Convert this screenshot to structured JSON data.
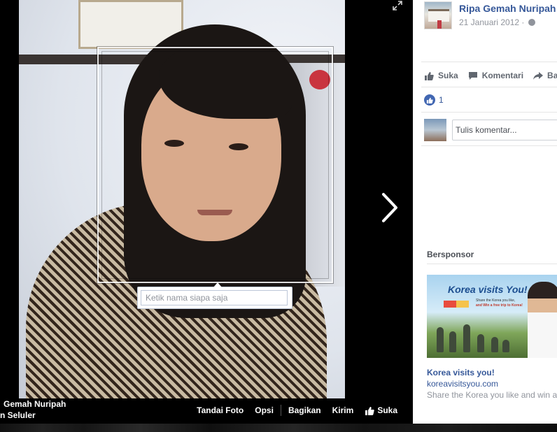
{
  "viewer": {
    "tag_input_placeholder": "Ketik nama siapa saja",
    "owner_name": "Gemah Nuripah",
    "owner_subtitle": "n Seluler",
    "actions": [
      "Tandai Foto",
      "Opsi",
      "Bagikan",
      "Kirim",
      "Suka"
    ]
  },
  "post": {
    "author": "Ripa Gemah Nuripah",
    "date": "21 Januari 2012 ·",
    "actions": [
      "Suka",
      "Komentari",
      "Ba"
    ],
    "like_count": "1",
    "comment_placeholder": "Tulis komentar..."
  },
  "sponsored": {
    "heading": "Bersponsor",
    "ad": {
      "image_headline": "Korea visits You!",
      "image_line1": "Share the Korea you like,",
      "image_line2": "and Win a free trip to Korea!",
      "title": "Korea visits you!",
      "url": "koreavisitsyou.com",
      "description": "Share the Korea you like and win a"
    }
  },
  "colors": {
    "link_blue": "#365899",
    "like_blue": "#4267b2",
    "muted_gray": "#90949c"
  }
}
